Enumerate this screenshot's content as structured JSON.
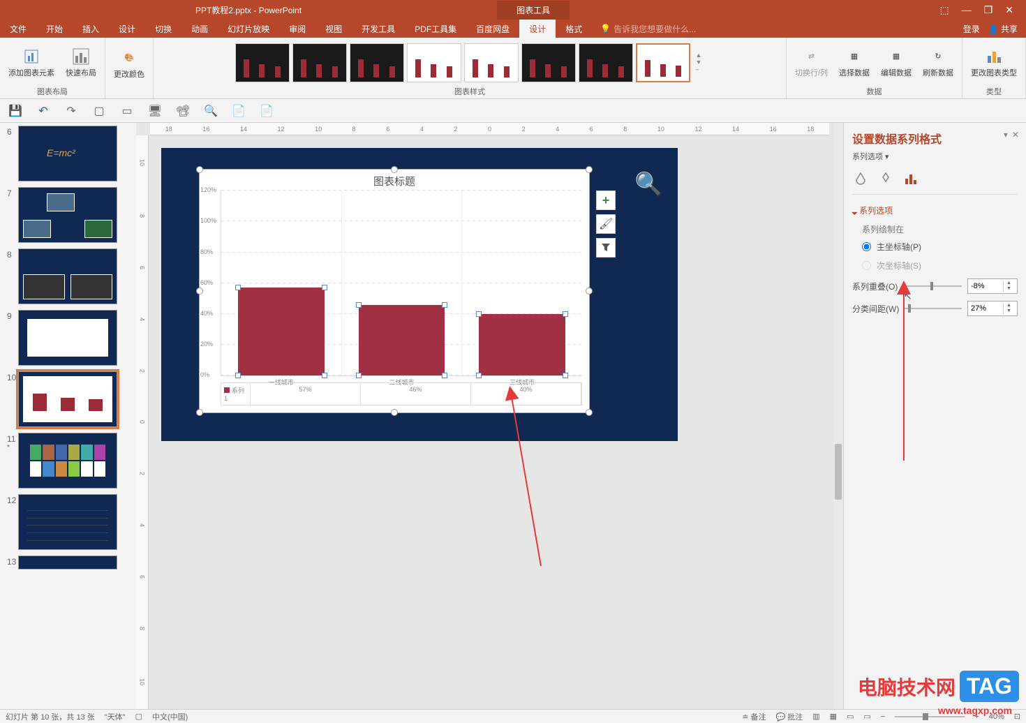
{
  "titlebar": {
    "filename": "PPT教程2.pptx - PowerPoint",
    "chart_tools": "图表工具"
  },
  "winbtns": {
    "options": "⬚",
    "min": "—",
    "max": "❐",
    "close": "✕"
  },
  "menubar": {
    "tabs": [
      "文件",
      "开始",
      "插入",
      "设计",
      "切换",
      "动画",
      "幻灯片放映",
      "审阅",
      "视图",
      "开发工具",
      "PDF工具集",
      "百度网盘",
      "设计",
      "格式"
    ],
    "active_index": 12,
    "tellme_icon": "lightbulb-icon",
    "tellme": "告诉我您想要做什么...",
    "login": "登录",
    "share": "共享"
  },
  "ribbon": {
    "layout_group": "图表布局",
    "add_element": "添加图表元素",
    "quick_layout": "快速布局",
    "change_colors": "更改颜色",
    "styles_group": "图表样式",
    "data_group": "数据",
    "switch_rowcol": "切换行/列",
    "select_data": "选择数据",
    "edit_data": "编辑数据",
    "refresh_data": "刷新数据",
    "type_group": "类型",
    "change_type": "更改图表类型"
  },
  "slides": [
    {
      "num": "6"
    },
    {
      "num": "7"
    },
    {
      "num": "8"
    },
    {
      "num": "9"
    },
    {
      "num": "10",
      "selected": true
    },
    {
      "num": "11",
      "star": "*"
    },
    {
      "num": "12"
    },
    {
      "num": "13"
    }
  ],
  "ruler_marks": [
    "18",
    "16",
    "14",
    "12",
    "10",
    "8",
    "6",
    "4",
    "2",
    "0",
    "2",
    "4",
    "6",
    "8",
    "10",
    "12",
    "14",
    "16",
    "18"
  ],
  "chart_data": {
    "type": "bar",
    "title": "图表标题",
    "categories": [
      "一线城市",
      "二线城市",
      "三线城市"
    ],
    "series_name": "系列1",
    "values": [
      57,
      46,
      40
    ],
    "value_labels": [
      "57%",
      "46%",
      "40%"
    ],
    "ylabel": "",
    "ylim": [
      0,
      120
    ],
    "yticks": [
      "0%",
      "20%",
      "40%",
      "60%",
      "80%",
      "100%",
      "120%"
    ]
  },
  "side_buttons": {
    "plus": "+",
    "brush": "brush-icon",
    "filter": "filter-icon"
  },
  "format_pane": {
    "title": "设置数据系列格式",
    "subtitle": "系列选项",
    "section": "系列选项",
    "plot_on": "系列绘制在",
    "primary_axis": "主坐标轴(P)",
    "secondary_axis": "次坐标轴(S)",
    "overlap_label": "系列重叠(O)",
    "overlap_value": "-8%",
    "gap_label": "分类间距(W)",
    "gap_value": "27%"
  },
  "statusbar": {
    "slide_info": "幻灯片 第 10 张，共 13 张",
    "theme": "\"天体\"",
    "lang": "中文(中国)",
    "remark": "备注",
    "comment": "批注",
    "zoom": "40%",
    "fit": "⊡"
  },
  "watermark": {
    "text": "电脑技术网",
    "tag": "TAG",
    "url": "www.tagxp.com"
  }
}
